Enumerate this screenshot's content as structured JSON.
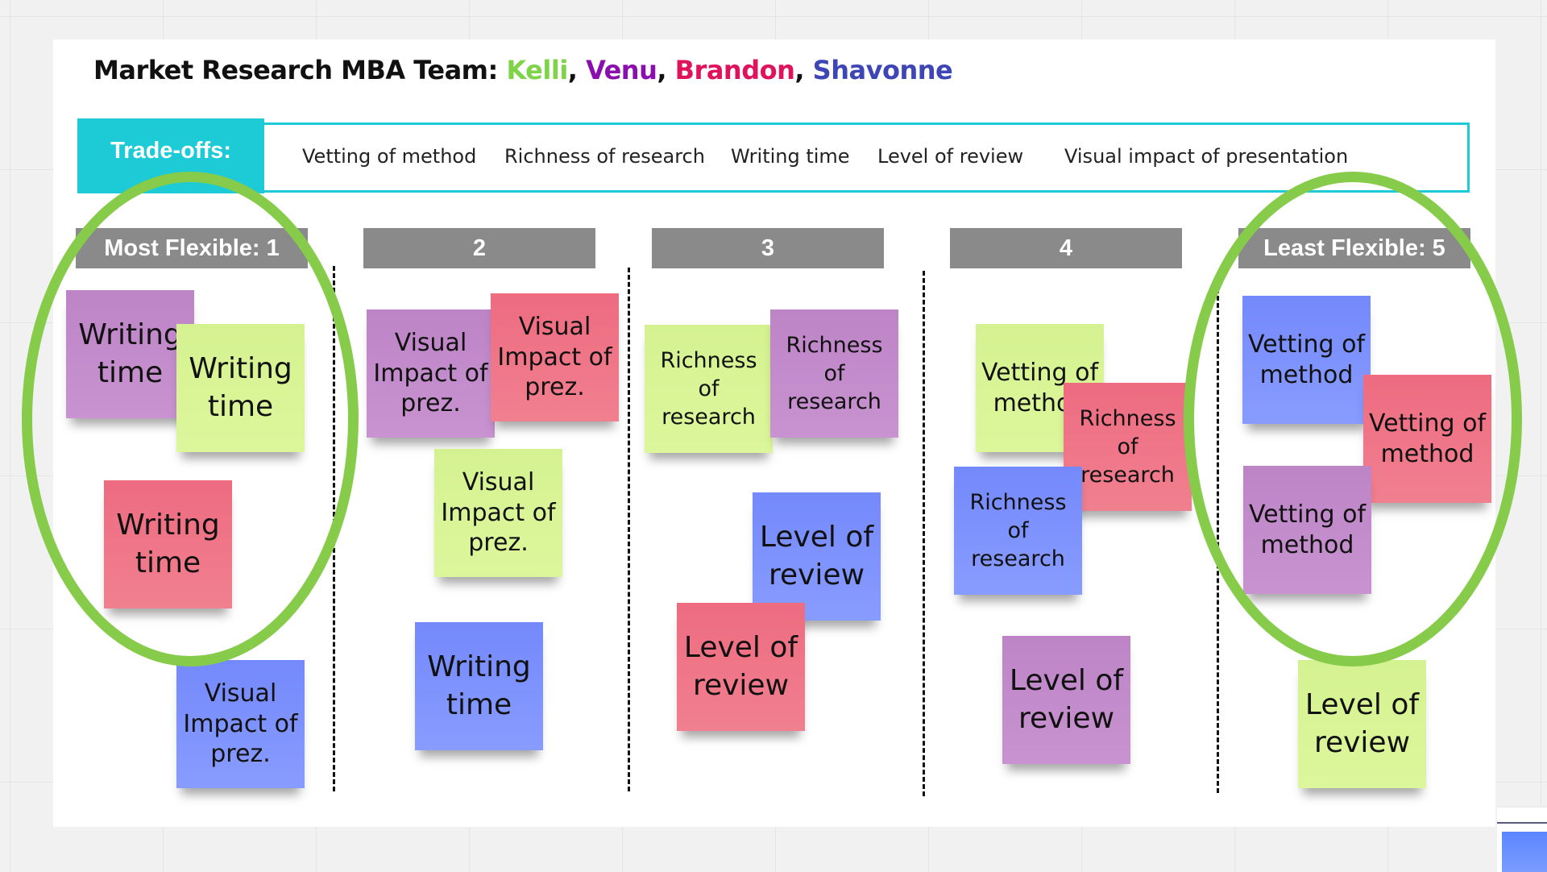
{
  "board": {
    "title_prefix": "Market Research MBA Team: ",
    "team": [
      {
        "name": "Kelli",
        "color": "#7ed348"
      },
      {
        "name": "Venu",
        "color": "#8a0fae"
      },
      {
        "name": "Brandon",
        "color": "#e0135a"
      },
      {
        "name": "Shavonne",
        "color": "#3e45b5"
      }
    ],
    "separator": ", ",
    "tradeoffs_label": "Trade-offs:",
    "tradeoffs": [
      "Vetting of method",
      "Richness of research",
      "Writing time",
      "Level of review",
      "Visual impact of presentation"
    ],
    "columns": [
      {
        "label": "Most Flexible: 1"
      },
      {
        "label": "2"
      },
      {
        "label": "3"
      },
      {
        "label": "4"
      },
      {
        "label": "Least Flexible: 5"
      }
    ],
    "notes": [
      {
        "column": 1,
        "text": "Writing time",
        "color": "purple"
      },
      {
        "column": 1,
        "text": "Writing time",
        "color": "green"
      },
      {
        "column": 1,
        "text": "Writing time",
        "color": "red"
      },
      {
        "column": 1,
        "text": "Visual Impact of prez.",
        "color": "blue"
      },
      {
        "column": 2,
        "text": "Visual Impact of prez.",
        "color": "purple"
      },
      {
        "column": 2,
        "text": "Visual Impact of prez.",
        "color": "red"
      },
      {
        "column": 2,
        "text": "Visual Impact of prez.",
        "color": "green"
      },
      {
        "column": 2,
        "text": "Writing time",
        "color": "blue"
      },
      {
        "column": 3,
        "text": "Richness of research",
        "color": "green"
      },
      {
        "column": 3,
        "text": "Richness of research",
        "color": "purple"
      },
      {
        "column": 3,
        "text": "Level of review",
        "color": "blue"
      },
      {
        "column": 3,
        "text": "Level of review",
        "color": "red"
      },
      {
        "column": 4,
        "text": "Vetting of method",
        "color": "green"
      },
      {
        "column": 4,
        "text": "Richness of research",
        "color": "red"
      },
      {
        "column": 4,
        "text": "Richness of research",
        "color": "blue"
      },
      {
        "column": 4,
        "text": "Level of review",
        "color": "purple"
      },
      {
        "column": 5,
        "text": "Vetting of method",
        "color": "blue"
      },
      {
        "column": 5,
        "text": "Vetting of method",
        "color": "red"
      },
      {
        "column": 5,
        "text": "Vetting of method",
        "color": "purple"
      },
      {
        "column": 5,
        "text": "Level of review",
        "color": "green"
      }
    ],
    "highlights": [
      {
        "column": 1,
        "shape": "oval",
        "color": "#86cc4a"
      },
      {
        "column": 5,
        "shape": "oval",
        "color": "#86cc4a"
      }
    ]
  }
}
